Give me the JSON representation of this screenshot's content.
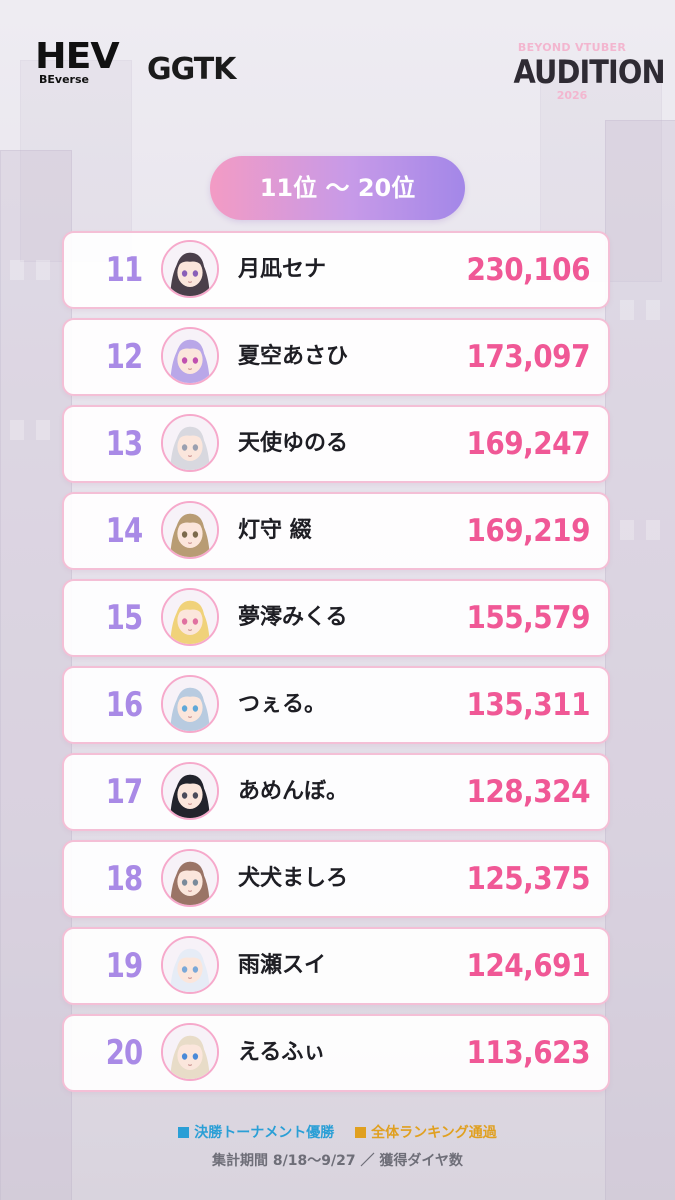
{
  "header": {
    "hev_logo": "HEV",
    "hev_sub": "BEverse",
    "ggtk_logo": "GGTK",
    "audition_top": "BEYOND VTUBER",
    "audition_main": "AUDITION",
    "audition_year": "2026"
  },
  "range_label": "11位 〜 20位",
  "rankings": [
    {
      "rank": "11",
      "name": "月凪セナ",
      "score": "230,106",
      "avatar_hair": "#4a3f4a",
      "avatar_eye": "#8a5fb8"
    },
    {
      "rank": "12",
      "name": "夏空あさひ",
      "score": "173,097",
      "avatar_hair": "#b9a7e8",
      "avatar_eye": "#c050b0"
    },
    {
      "rank": "13",
      "name": "天使ゆのる",
      "score": "169,247",
      "avatar_hair": "#d8d8df",
      "avatar_eye": "#9aa0b0"
    },
    {
      "rank": "14",
      "name": "灯守 綴",
      "score": "169,219",
      "avatar_hair": "#b89c74",
      "avatar_eye": "#7c6a4c"
    },
    {
      "rank": "15",
      "name": "夢澪みくる",
      "score": "155,579",
      "avatar_hair": "#f0d27a",
      "avatar_eye": "#e070a0"
    },
    {
      "rank": "16",
      "name": "つぇる。",
      "score": "135,311",
      "avatar_hair": "#b8cbe0",
      "avatar_eye": "#5fa8d8"
    },
    {
      "rank": "17",
      "name": "あめんぼ。",
      "score": "128,324",
      "avatar_hair": "#22232c",
      "avatar_eye": "#4a4a5a"
    },
    {
      "rank": "18",
      "name": "犬犬ましろ",
      "score": "125,375",
      "avatar_hair": "#9a7466",
      "avatar_eye": "#7a8a9a"
    },
    {
      "rank": "19",
      "name": "雨瀬スイ",
      "score": "124,691",
      "avatar_hair": "#e6ecf6",
      "avatar_eye": "#7aa8d8"
    },
    {
      "rank": "20",
      "name": "えるふぃ",
      "score": "113,623",
      "avatar_hair": "#e8dcc8",
      "avatar_eye": "#4a8ad8"
    }
  ],
  "legend": {
    "tournament_label": "決勝トーナメント優勝",
    "tournament_color": "#2a9fd6",
    "overall_label": "全体ランキング通過",
    "overall_color": "#e0a020"
  },
  "footer": "集計期間 8/18〜9/27 ／ 獲得ダイヤ数"
}
